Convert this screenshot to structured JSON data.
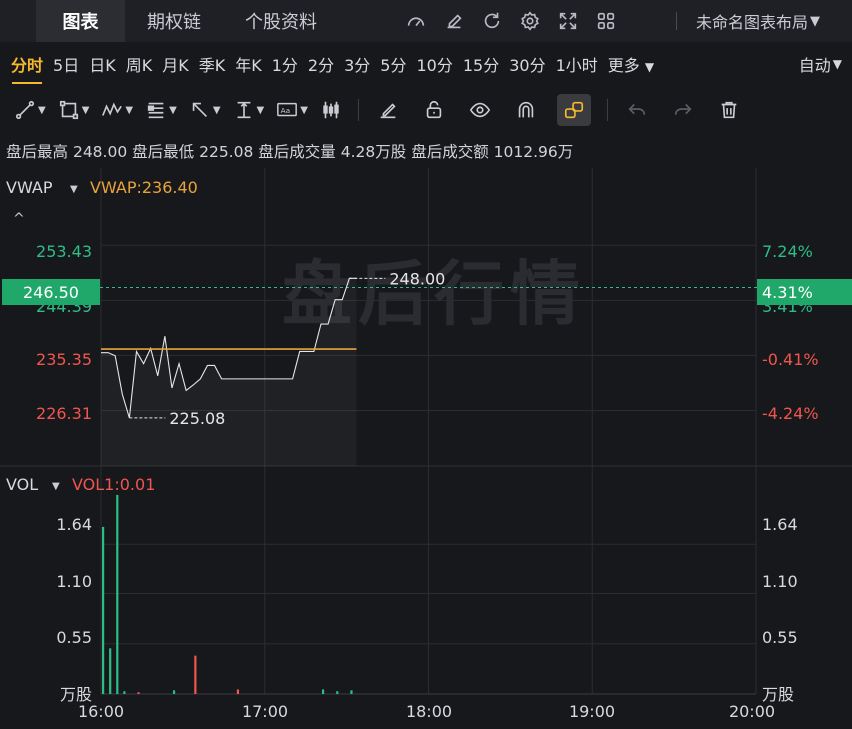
{
  "tabs": [
    {
      "label": "图表",
      "active": true
    },
    {
      "label": "期权链"
    },
    {
      "label": "个股资料"
    }
  ],
  "top_icons": [
    "gauge-icon",
    "edit-icon",
    "refresh-icon",
    "settings-icon",
    "fullscreen-icon",
    "grid-icon"
  ],
  "layout_label": "未命名图表布局",
  "periods": [
    "分时",
    "5日",
    "日K",
    "周K",
    "月K",
    "季K",
    "年K",
    "1分",
    "2分",
    "3分",
    "5分",
    "10分",
    "15分",
    "30分",
    "1小时",
    "更多"
  ],
  "auto_label": "自动",
  "info": {
    "high_label": "盘后最高",
    "high": "248.00",
    "low_label": "盘后最低",
    "low": "225.08",
    "volume_label": "盘后成交量",
    "volume": "4.28万股",
    "amount_label": "盘后成交额",
    "amount": "1012.96万"
  },
  "main_chart": {
    "indicator": "VWAP",
    "indicator_value": "VWAP:236.40",
    "y_left": [
      "253.43",
      "244.39",
      "235.35",
      "226.31"
    ],
    "y_right": [
      "7.24%",
      "3.41%",
      "-0.41%",
      "-4.24%"
    ],
    "current_price": "246.50",
    "current_pct": "4.31%",
    "max_label": "248.00",
    "min_label": "225.08",
    "watermark": "盘后行情",
    "colors": {
      "up": "#2ebd85",
      "down": "#f0554e",
      "vwap": "#e8a33b",
      "price_line": "#e6e6e6"
    }
  },
  "chart_data": {
    "type": "line",
    "x": [
      "16:00",
      "16:01",
      "16:02",
      "16:03",
      "16:04",
      "16:05",
      "16:06",
      "16:07",
      "16:08",
      "16:09",
      "16:10",
      "16:11",
      "16:12",
      "16:13",
      "16:14",
      "16:15",
      "16:16",
      "16:17",
      "16:18",
      "16:19",
      "16:20",
      "16:21",
      "16:22",
      "16:23",
      "16:24",
      "16:25",
      "16:26",
      "16:27",
      "16:28",
      "16:29",
      "16:30",
      "16:31",
      "16:32",
      "16:33",
      "16:34",
      "16:35",
      "16:36"
    ],
    "series": [
      {
        "name": "",
        "values": [
          235.8,
          235.8,
          235.3,
          229.0,
          225.1,
          236.0,
          234.0,
          236.5,
          232.0,
          238.5,
          230.0,
          234.0,
          229.6,
          230.5,
          231.5,
          233.7,
          233.7,
          231.5,
          231.5,
          231.5,
          231.5,
          231.5,
          231.5,
          231.5,
          231.5,
          231.5,
          231.5,
          231.5,
          236.0,
          236.0,
          236.0,
          240.5,
          240.5,
          244.5,
          244.5,
          248.0,
          248.0
        ]
      },
      {
        "name": "VWAP",
        "values": [
          236.4,
          236.4,
          236.4,
          236.4,
          236.4,
          236.4,
          236.4,
          236.4,
          236.4,
          236.4,
          236.4,
          236.4,
          236.4,
          236.4,
          236.4,
          236.4,
          236.4,
          236.4,
          236.4,
          236.4,
          236.4,
          236.4,
          236.4,
          236.4,
          236.4,
          236.4,
          236.4,
          236.4,
          236.4,
          236.4,
          236.4,
          236.4,
          236.4,
          236.4,
          236.4,
          236.4,
          236.4
        ]
      }
    ],
    "ylim": [
      221.8,
      257.9
    ],
    "y_ticks": [
      253.43,
      244.39,
      235.35,
      226.31
    ],
    "x_ticks": [
      "16:00",
      "17:00",
      "18:00",
      "19:00",
      "20:00"
    ],
    "xlim_minutes": [
      0,
      240
    ],
    "grid": true,
    "volume": {
      "indicator": "VOL",
      "indicator_value": "VOL1:0.01",
      "unit": "万股",
      "y_ticks": [
        "1.64",
        "1.10",
        "0.55"
      ],
      "ylim": [
        0,
        2.19
      ],
      "bars": [
        {
          "t": 0,
          "v": 1.83,
          "dir": "up"
        },
        {
          "t": 1,
          "v": 0.5,
          "dir": "up"
        },
        {
          "t": 2,
          "v": 2.18,
          "dir": "up"
        },
        {
          "t": 3,
          "v": 0.03,
          "dir": "up"
        },
        {
          "t": 5,
          "v": 0.02,
          "dir": "down"
        },
        {
          "t": 10,
          "v": 0.04,
          "dir": "up"
        },
        {
          "t": 13,
          "v": 0.42,
          "dir": "down"
        },
        {
          "t": 19,
          "v": 0.05,
          "dir": "down"
        },
        {
          "t": 31,
          "v": 0.05,
          "dir": "up"
        },
        {
          "t": 33,
          "v": 0.03,
          "dir": "up"
        },
        {
          "t": 35,
          "v": 0.04,
          "dir": "up"
        }
      ]
    }
  }
}
